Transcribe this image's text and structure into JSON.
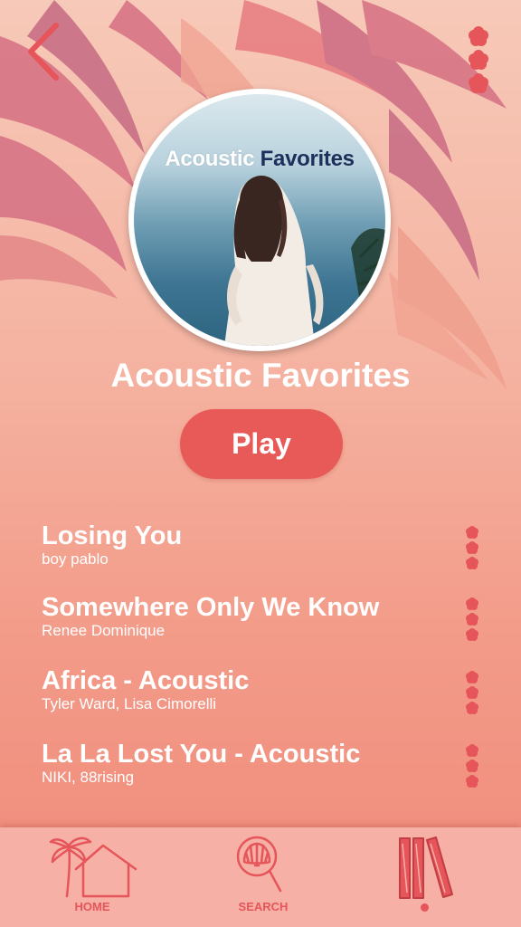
{
  "playlist": {
    "title": "Acoustic Favorites",
    "cover_text": {
      "word1": "Acoustic",
      "word2": "Favorites"
    },
    "play_label": "Play"
  },
  "tracks": [
    {
      "title": "Losing You",
      "artist": "boy pablo"
    },
    {
      "title": "Somewhere Only We Know",
      "artist": "Renee Dominique"
    },
    {
      "title": "Africa - Acoustic",
      "artist": "Tyler Ward, Lisa Cimorelli"
    },
    {
      "title": "La La Lost You - Acoustic",
      "artist": "NIKI, 88rising"
    }
  ],
  "tabbar": {
    "home_label": "HOME",
    "search_label": "SEARCH",
    "active_tab": "library"
  },
  "icons": {
    "back": "chevron-left-icon",
    "menu": "flower-dots-menu-icon",
    "track_more": "flower-dots-icon",
    "home": "palm-house-icon",
    "search": "shell-magnifier-icon",
    "library": "books-icon"
  },
  "colors": {
    "accent": "#e85a58",
    "icon": "#e5555a",
    "tabbar_bg": "#f7b0a6",
    "leaf_dark": "#d77486",
    "leaf_light": "#f0a08f"
  }
}
